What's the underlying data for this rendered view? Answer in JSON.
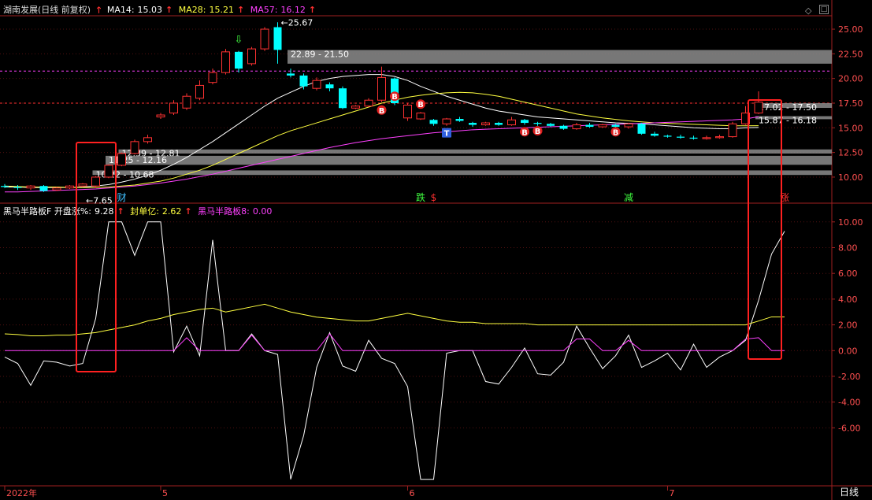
{
  "stock_name": "湖南发展(日线 前复权)",
  "top_indicators": [
    {
      "label": "MA14:",
      "value": "15.03",
      "color": "#ffffff"
    },
    {
      "label": "MA28:",
      "value": "15.21",
      "color": "#ffff40"
    },
    {
      "label": "MA57:",
      "value": "16.12",
      "color": "#ff40ff"
    }
  ],
  "bottom_indicators": [
    {
      "label": "黑马半路板F 开盘涨%:",
      "value": "9.28",
      "color": "#ffffff"
    },
    {
      "label": "封单亿:",
      "value": "2.62",
      "color": "#ffff40"
    },
    {
      "label": "黑马半路板8:",
      "value": "0.00",
      "color": "#ff40ff"
    }
  ],
  "period_label": "日线",
  "chart_data": [
    {
      "type": "candlestick",
      "y_ticks": [
        25.0,
        22.5,
        20.0,
        17.5,
        15.0,
        12.5,
        10.0
      ],
      "ylim": [
        8.0,
        26.2
      ],
      "x_labels": [
        {
          "text": "2022年",
          "index": 0
        },
        {
          "text": "5",
          "index": 12
        },
        {
          "text": "6",
          "index": 31
        },
        {
          "text": "7",
          "index": 51
        }
      ],
      "candles": [
        [
          9.1,
          9.0,
          9.3,
          8.9
        ],
        [
          9.0,
          8.9,
          9.2,
          8.7
        ],
        [
          8.9,
          9.1,
          9.2,
          8.7
        ],
        [
          9.1,
          8.6,
          9.2,
          8.5
        ],
        [
          8.7,
          8.9,
          9.0,
          8.6
        ],
        [
          8.9,
          9.1,
          9.2,
          8.8
        ],
        [
          9.1,
          9.3,
          9.4,
          9.0
        ],
        [
          9.1,
          10.0,
          10.1,
          8.9
        ],
        [
          10.0,
          11.2,
          11.3,
          9.9
        ],
        [
          11.2,
          12.4,
          12.5,
          11.1
        ],
        [
          12.4,
          13.6,
          13.8,
          12.3
        ],
        [
          13.6,
          14.0,
          14.3,
          13.4
        ],
        [
          16.1,
          16.3,
          16.5,
          15.9
        ],
        [
          16.5,
          17.5,
          17.8,
          16.3
        ],
        [
          17.0,
          18.2,
          18.5,
          16.8
        ],
        [
          18.0,
          19.3,
          19.8,
          17.8
        ],
        [
          19.6,
          20.6,
          21.0,
          19.4
        ],
        [
          20.6,
          22.7,
          23.0,
          20.4
        ],
        [
          22.7,
          21.0,
          22.8,
          20.6
        ],
        [
          21.5,
          23.0,
          23.2,
          21.3
        ],
        [
          23.0,
          25.0,
          25.2,
          22.8
        ],
        [
          25.2,
          22.9,
          25.7,
          21.5
        ],
        [
          20.5,
          20.3,
          21.0,
          20.1
        ],
        [
          20.3,
          19.2,
          20.5,
          18.9
        ],
        [
          19.0,
          19.8,
          20.1,
          18.8
        ],
        [
          19.4,
          19.0,
          19.6,
          18.7
        ],
        [
          19.0,
          17.0,
          19.2,
          16.9
        ],
        [
          17.0,
          17.2,
          17.3,
          16.9
        ],
        [
          17.2,
          17.8,
          18.0,
          17.1
        ],
        [
          17.8,
          20.1,
          21.2,
          17.6
        ],
        [
          20.0,
          17.5,
          20.1,
          17.3
        ],
        [
          16.0,
          17.3,
          17.5,
          15.7
        ],
        [
          15.9,
          16.5,
          16.6,
          15.8
        ],
        [
          15.8,
          15.4,
          15.9,
          15.2
        ],
        [
          15.4,
          15.9,
          16.0,
          15.2
        ],
        [
          15.9,
          15.7,
          16.1,
          15.6
        ],
        [
          15.5,
          15.3,
          15.6,
          15.1
        ],
        [
          15.3,
          15.5,
          15.6,
          15.2
        ],
        [
          15.5,
          15.3,
          15.6,
          15.2
        ],
        [
          15.3,
          15.8,
          16.1,
          15.2
        ],
        [
          15.8,
          15.5,
          15.9,
          15.3
        ],
        [
          15.5,
          15.4,
          15.6,
          15.2
        ],
        [
          15.4,
          15.2,
          15.5,
          15.1
        ],
        [
          15.2,
          14.9,
          15.3,
          14.8
        ],
        [
          14.9,
          15.3,
          15.5,
          14.8
        ],
        [
          15.3,
          15.1,
          15.5,
          15.0
        ],
        [
          15.1,
          15.3,
          15.4,
          15.0
        ],
        [
          15.3,
          15.1,
          15.4,
          15.0
        ],
        [
          15.1,
          15.4,
          15.5,
          14.9
        ],
        [
          15.4,
          14.4,
          15.5,
          14.3
        ],
        [
          14.4,
          14.2,
          14.6,
          14.1
        ],
        [
          14.2,
          14.1,
          14.3,
          14.0
        ],
        [
          14.1,
          14.0,
          14.3,
          13.9
        ],
        [
          14.0,
          13.9,
          14.2,
          13.8
        ],
        [
          13.9,
          14.0,
          14.2,
          13.8
        ],
        [
          14.0,
          14.1,
          14.3,
          13.9
        ],
        [
          14.1,
          15.4,
          15.6,
          14.0
        ],
        [
          15.4,
          16.5,
          17.2,
          15.3
        ],
        [
          16.5,
          17.6,
          18.7,
          16.4
        ]
      ],
      "series": [
        {
          "name": "MA14",
          "color": "#ffffff",
          "values": [
            9.0,
            9.0,
            8.95,
            8.95,
            8.95,
            8.95,
            9.0,
            9.1,
            9.25,
            9.5,
            9.8,
            10.2,
            10.7,
            11.3,
            12.0,
            12.8,
            13.6,
            14.5,
            15.4,
            16.3,
            17.2,
            18.0,
            18.6,
            19.2,
            19.7,
            20.0,
            20.2,
            20.3,
            20.4,
            20.4,
            20.2,
            19.8,
            19.2,
            18.7,
            18.2,
            17.8,
            17.4,
            17.0,
            16.7,
            16.5,
            16.3,
            16.1,
            16.0,
            15.9,
            15.8,
            15.7,
            15.6,
            15.5,
            15.45,
            15.4,
            15.3,
            15.2,
            15.1,
            15.0,
            14.95,
            14.9,
            14.9,
            15.0,
            15.03
          ]
        },
        {
          "name": "MA28",
          "color": "#ffff40",
          "values": [
            9.1,
            9.05,
            9.0,
            9.0,
            9.0,
            8.95,
            8.95,
            8.95,
            9.0,
            9.1,
            9.2,
            9.4,
            9.6,
            9.9,
            10.3,
            10.7,
            11.2,
            11.8,
            12.4,
            13.0,
            13.6,
            14.2,
            14.7,
            15.1,
            15.5,
            15.9,
            16.3,
            16.7,
            17.1,
            17.5,
            17.8,
            18.1,
            18.3,
            18.45,
            18.55,
            18.6,
            18.55,
            18.4,
            18.2,
            17.9,
            17.6,
            17.3,
            17.0,
            16.7,
            16.4,
            16.2,
            16.0,
            15.85,
            15.7,
            15.6,
            15.5,
            15.45,
            15.4,
            15.35,
            15.3,
            15.25,
            15.2,
            15.2,
            15.21
          ]
        },
        {
          "name": "MA57",
          "color": "#ff40ff",
          "values": [
            8.5,
            8.5,
            8.55,
            8.6,
            8.65,
            8.7,
            8.75,
            8.8,
            8.9,
            9.0,
            9.1,
            9.25,
            9.4,
            9.6,
            9.8,
            10.05,
            10.3,
            10.6,
            10.9,
            11.2,
            11.5,
            11.8,
            12.1,
            12.4,
            12.7,
            13.0,
            13.25,
            13.5,
            13.7,
            13.9,
            14.05,
            14.2,
            14.35,
            14.5,
            14.6,
            14.7,
            14.8,
            14.85,
            14.9,
            14.95,
            15.0,
            15.05,
            15.1,
            15.15,
            15.2,
            15.25,
            15.3,
            15.35,
            15.4,
            15.45,
            15.5,
            15.55,
            15.6,
            15.65,
            15.7,
            15.75,
            15.8,
            15.9,
            16.12
          ]
        }
      ],
      "horizontal_refs": [
        {
          "value": 20.75,
          "color": "#ff40ff"
        },
        {
          "value": 17.5,
          "color": "#ff3030"
        }
      ],
      "zones": [
        {
          "label": "22.89 - 21.50",
          "top": 22.89,
          "bottom": 21.5,
          "start": 22
        },
        {
          "label": "17.02 - 17.50",
          "top": 17.5,
          "bottom": 17.02,
          "start": 58
        },
        {
          "label": "15.87 - 16.18",
          "top": 16.18,
          "bottom": 15.87,
          "start": 58
        },
        {
          "label": "12.39 - 12.81",
          "top": 12.81,
          "bottom": 12.39,
          "start": 9
        },
        {
          "label": "11.25 - 12.16",
          "top": 12.16,
          "bottom": 11.25,
          "start": 8
        },
        {
          "label": "10.22 - 10.68",
          "top": 10.68,
          "bottom": 10.22,
          "start": 7
        }
      ],
      "annotations": [
        {
          "text": "←7.65",
          "index": 6,
          "value": 7.65,
          "color": "#ffffff"
        },
        {
          "text": "←25.67",
          "index": 21,
          "value": 25.67,
          "color": "#ffffff"
        }
      ],
      "markers": [
        {
          "text": "B",
          "index": 29,
          "value": 16.8,
          "kind": "B"
        },
        {
          "text": "B",
          "index": 30,
          "value": 18.2,
          "kind": "B"
        },
        {
          "text": "B",
          "index": 32,
          "value": 17.4,
          "kind": "B"
        },
        {
          "text": "B",
          "index": 40,
          "value": 14.6,
          "kind": "B"
        },
        {
          "text": "B",
          "index": 41,
          "value": 14.7,
          "kind": "B"
        },
        {
          "text": "B",
          "index": 47,
          "value": 14.6,
          "kind": "B"
        },
        {
          "text": "T",
          "index": 34,
          "value": 14.5,
          "kind": "T"
        },
        {
          "text": "⇩",
          "index": 18,
          "value": 23.6,
          "kind": "arrow"
        }
      ],
      "event_labels": [
        {
          "text": "财",
          "index": 9,
          "color": "#40c0ff"
        },
        {
          "text": "跌",
          "index": 32,
          "color": "#40ff40"
        },
        {
          "text": "$",
          "index": 33,
          "color": "#ff3030"
        },
        {
          "text": "减",
          "index": 48,
          "color": "#40ff40"
        },
        {
          "text": "涨",
          "index": 60,
          "color": "#ff3030"
        }
      ]
    },
    {
      "type": "line",
      "y_ticks": [
        10.0,
        8.0,
        6.0,
        4.0,
        2.0,
        0.0,
        -2.0,
        -4.0,
        -6.0
      ],
      "ylim": [
        -10.2,
        10.6
      ],
      "series": [
        {
          "name": "开盘涨%",
          "color": "#ffffff",
          "values": [
            -0.5,
            -1.0,
            -2.7,
            -0.8,
            -0.9,
            -1.2,
            -1.0,
            2.5,
            10.0,
            10.0,
            7.4,
            10.0,
            10.0,
            -0.1,
            1.9,
            -0.4,
            8.6,
            0.0,
            0.0,
            1.3,
            0.0,
            -0.3,
            -10.0,
            -6.6,
            -1.3,
            1.4,
            -1.2,
            -1.6,
            0.8,
            -0.6,
            -1.0,
            -2.8,
            -10.0,
            -10.0,
            -0.2,
            0.0,
            0.0,
            -2.4,
            -2.6,
            -1.3,
            0.2,
            -1.8,
            -1.9,
            -0.9,
            1.9,
            0.2,
            -1.4,
            -0.4,
            1.2,
            -1.3,
            -0.8,
            -0.2,
            -1.5,
            0.5,
            -1.3,
            -0.5,
            0.0,
            0.8,
            3.9,
            7.5,
            9.28
          ]
        },
        {
          "name": "封单亿",
          "color": "#ffff40",
          "values": [
            1.3,
            1.25,
            1.15,
            1.15,
            1.2,
            1.2,
            1.3,
            1.4,
            1.6,
            1.8,
            2.0,
            2.3,
            2.5,
            2.8,
            3.0,
            3.2,
            3.3,
            3.0,
            3.2,
            3.4,
            3.6,
            3.3,
            3.0,
            2.8,
            2.6,
            2.5,
            2.4,
            2.3,
            2.3,
            2.5,
            2.7,
            2.9,
            2.7,
            2.5,
            2.3,
            2.2,
            2.2,
            2.1,
            2.1,
            2.1,
            2.1,
            2.0,
            2.0,
            2.0,
            2.0,
            2.0,
            2.0,
            2.0,
            2.0,
            2.0,
            2.0,
            2.0,
            2.0,
            2.0,
            2.0,
            2.0,
            2.0,
            2.0,
            2.3,
            2.62,
            2.62
          ]
        },
        {
          "name": "黑马半路板8",
          "color": "#ff40ff",
          "values": [
            0,
            0,
            0,
            0,
            0,
            0,
            0,
            0,
            0,
            0,
            0,
            0,
            0,
            0,
            1.0,
            0,
            0,
            0,
            0,
            1.2,
            0,
            0,
            0,
            0,
            0,
            1.3,
            0,
            0,
            0,
            0,
            0,
            0,
            0,
            0,
            0,
            0,
            0,
            0,
            0,
            0,
            0,
            0,
            0,
            0,
            0.9,
            0.9,
            0,
            0,
            0.8,
            0,
            0,
            0,
            0,
            0,
            0,
            0,
            0,
            0.9,
            1.0,
            0.0,
            0.0
          ]
        }
      ]
    }
  ]
}
